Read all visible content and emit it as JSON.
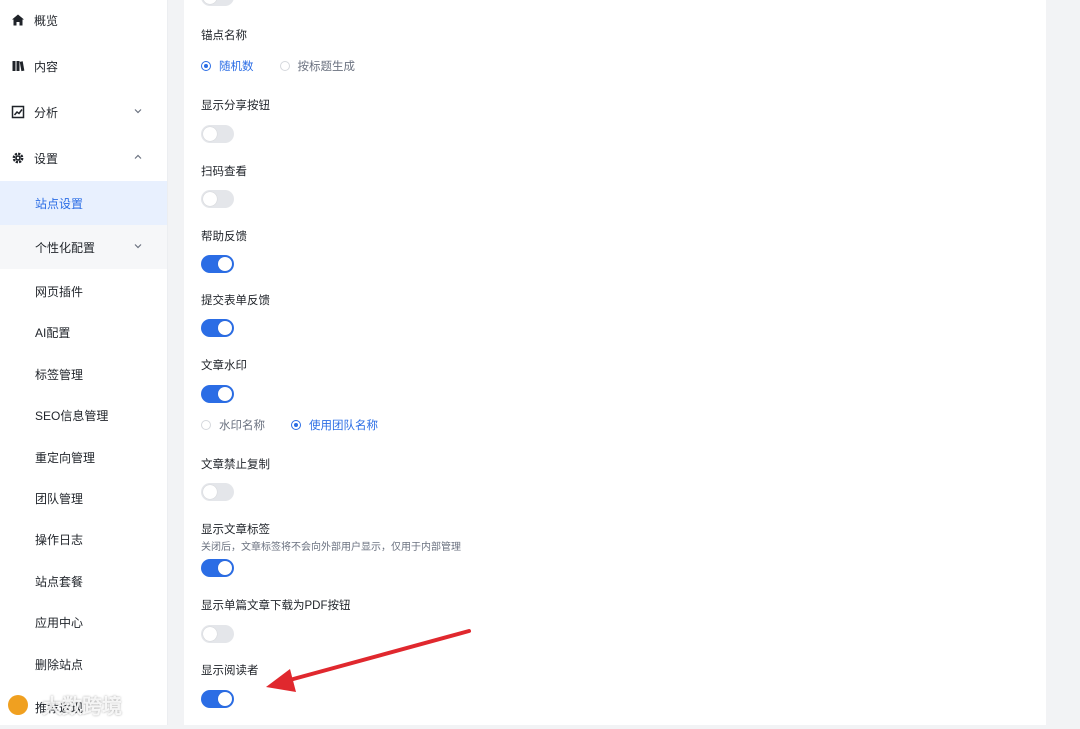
{
  "sidebar": {
    "items": [
      {
        "label": "概览",
        "icon": "home-icon"
      },
      {
        "label": "内容",
        "icon": "book-icon"
      },
      {
        "label": "分析",
        "icon": "chart-icon"
      },
      {
        "label": "设置",
        "icon": "gear-icon"
      }
    ],
    "settings_children": [
      {
        "label": "站点设置",
        "active": true
      },
      {
        "label": "个性化配置"
      },
      {
        "label": "网页插件"
      },
      {
        "label": "AI配置"
      },
      {
        "label": "标签管理"
      },
      {
        "label": "SEO信息管理"
      },
      {
        "label": "重定向管理"
      },
      {
        "label": "团队管理"
      },
      {
        "label": "操作日志"
      },
      {
        "label": "站点套餐"
      },
      {
        "label": "应用中心"
      },
      {
        "label": "删除站点"
      },
      {
        "label": "推荐返现"
      }
    ]
  },
  "settings": {
    "anchor_name": {
      "label": "锚点名称",
      "options": [
        "随机数",
        "按标题生成"
      ],
      "selected": "随机数"
    },
    "show_share_button": {
      "label": "显示分享按钮",
      "enabled": false
    },
    "scan_view": {
      "label": "扫码查看",
      "enabled": false
    },
    "help_feedback": {
      "label": "帮助反馈",
      "enabled": true
    },
    "form_feedback": {
      "label": "提交表单反馈",
      "enabled": true
    },
    "article_watermark": {
      "label": "文章水印",
      "enabled": true,
      "options": [
        "水印名称",
        "使用团队名称"
      ],
      "selected": "使用团队名称"
    },
    "disable_copy": {
      "label": "文章禁止复制",
      "enabled": false
    },
    "show_article_tags": {
      "label": "显示文章标签",
      "description": "关闭后，文章标签将不会向外部用户显示，仅用于内部管理",
      "enabled": true
    },
    "show_pdf_download": {
      "label": "显示单篇文章下载为PDF按钮",
      "enabled": false
    },
    "show_readers": {
      "label": "显示阅读者",
      "enabled": true
    }
  },
  "watermark": {
    "text": "大数跨境"
  },
  "colors": {
    "accent": "#2b6de5",
    "annotation_arrow": "#e0282e"
  }
}
